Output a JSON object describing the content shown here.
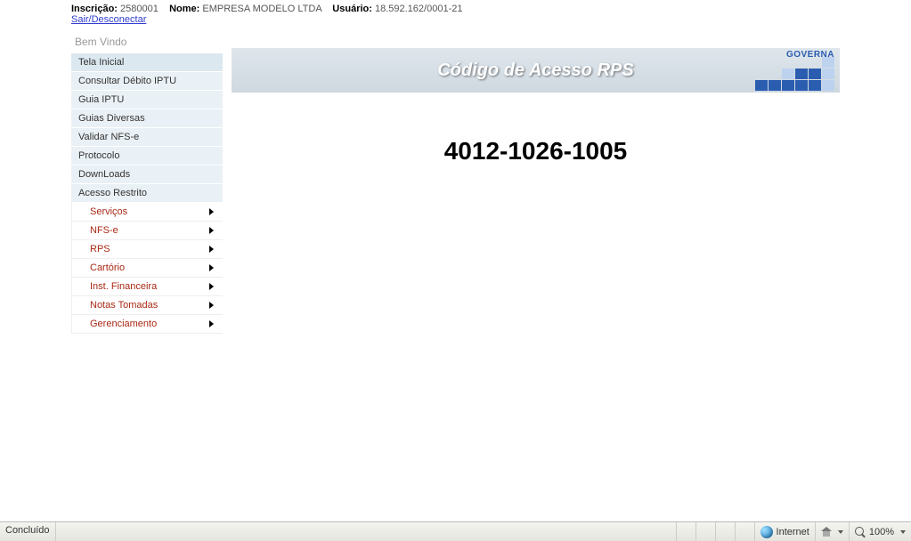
{
  "header": {
    "inscricao_label": "Inscrição:",
    "inscricao_value": "2580001",
    "nome_label": "Nome:",
    "nome_value": "EMPRESA MODELO LTDA",
    "usuario_label": "Usuário:",
    "usuario_value": "18.592.162/0001-21",
    "logout": "Sair/Desconectar"
  },
  "sidebar": {
    "welcome": "Bem Vindo",
    "items": [
      {
        "label": "Tela Inicial"
      },
      {
        "label": "Consultar Débito IPTU"
      },
      {
        "label": "Guia IPTU"
      },
      {
        "label": "Guias Diversas"
      },
      {
        "label": "Validar NFS-e"
      },
      {
        "label": "Protocolo"
      },
      {
        "label": "DownLoads"
      },
      {
        "label": "Acesso Restrito"
      }
    ],
    "subitems": [
      {
        "label": "Serviços"
      },
      {
        "label": "NFS-e"
      },
      {
        "label": "RPS"
      },
      {
        "label": "Cartório"
      },
      {
        "label": "Inst. Financeira"
      },
      {
        "label": "Notas Tomadas"
      },
      {
        "label": "Gerenciamento"
      }
    ]
  },
  "banner": {
    "title": "Código de Acesso RPS",
    "brand": "GOVERNA"
  },
  "main": {
    "access_code": "4012-1026-1005"
  },
  "statusbar": {
    "status": "Concluído",
    "zone": "Internet",
    "zoom": "100%"
  }
}
